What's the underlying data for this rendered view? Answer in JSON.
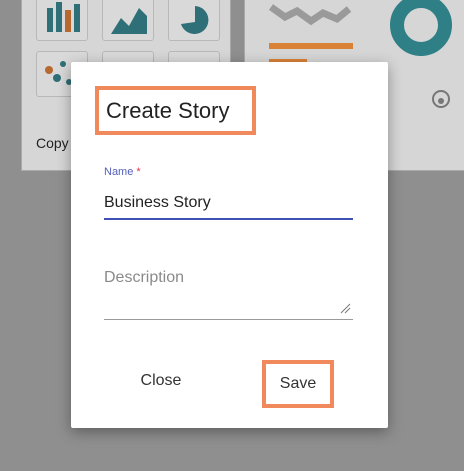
{
  "background": {
    "copy_label": "Copy"
  },
  "dialog": {
    "title": "Create Story",
    "name_field": {
      "label": "Name",
      "required_marker": "*",
      "value": "Business Story"
    },
    "description_field": {
      "placeholder": "Description",
      "value": ""
    },
    "close_label": "Close",
    "save_label": "Save"
  },
  "colors": {
    "accent": "#3f51b5",
    "label": "#5560b8",
    "required": "#e0344a",
    "highlight": "#f08a5d",
    "chart_teal": "#2f6f77",
    "chart_orange": "#b8692f"
  }
}
